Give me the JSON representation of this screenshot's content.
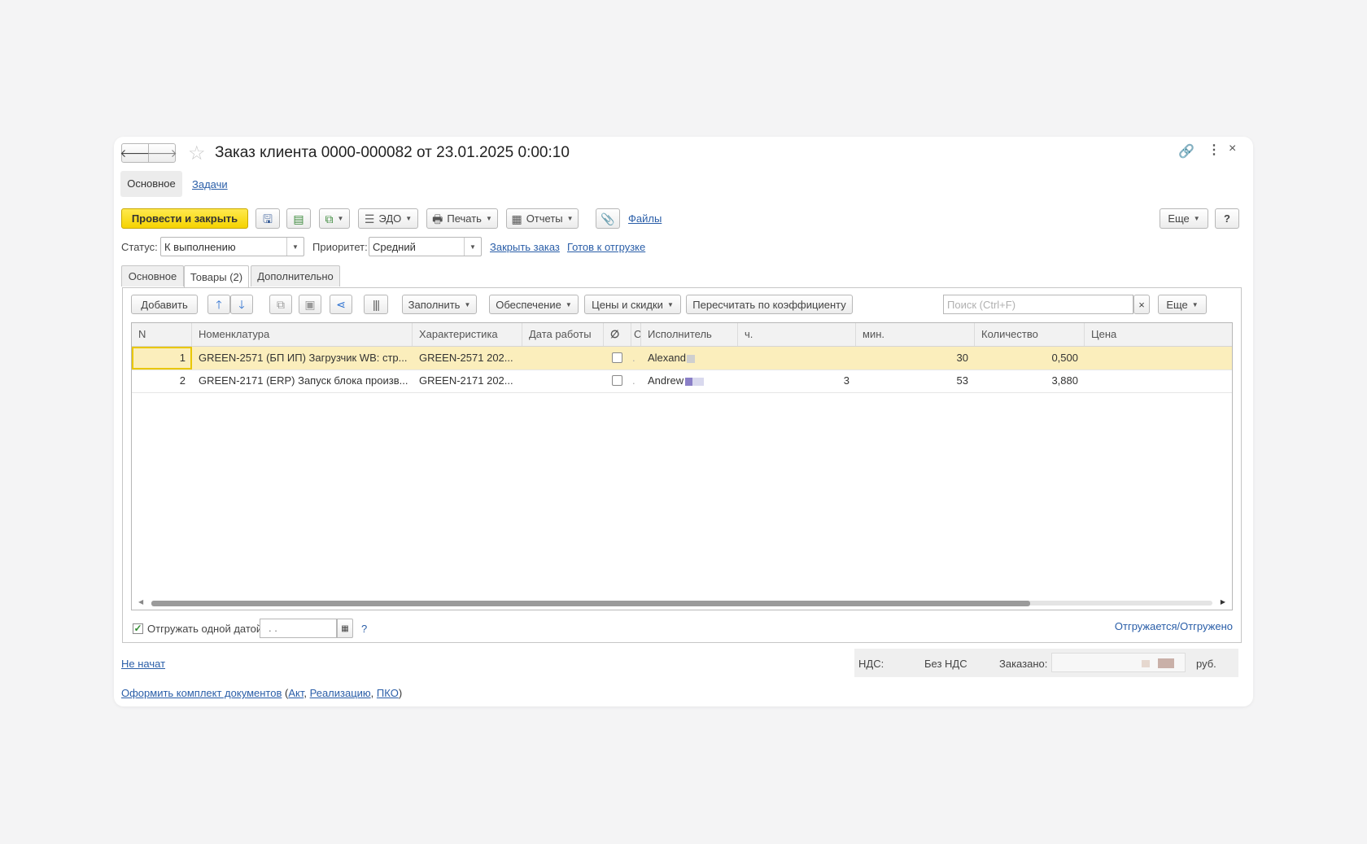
{
  "window": {
    "title": "Заказ клиента 0000-000082 от 23.01.2025 0:00:10",
    "nav_tabs": [
      "Основное",
      "Задачи"
    ]
  },
  "toolbar": {
    "post_close": "Провести и закрыть",
    "edo": "ЭДО",
    "print": "Печать",
    "reports": "Отчеты",
    "files": "Файлы",
    "more": "Еще",
    "help": "?"
  },
  "status_row": {
    "status_label": "Статус:",
    "status_value": "К выполнению",
    "priority_label": "Приоритет:",
    "priority_value": "Средний",
    "close_order": "Закрыть заказ",
    "ready_ship": "Готов к отгрузке"
  },
  "tabs": [
    "Основное",
    "Товары (2)",
    "Дополнительно"
  ],
  "table_toolbar": {
    "add": "Добавить",
    "fill": "Заполнить",
    "supply": "Обеспечение",
    "prices": "Цены и скидки",
    "recalc": "Пересчитать по коэффициенту",
    "search_placeholder": "Поиск (Ctrl+F)",
    "clear": "×",
    "more": "Еще"
  },
  "table": {
    "columns": [
      "N",
      "Номенклатура",
      "Характеристика",
      "Дата работы",
      "∅",
      "С",
      "Исполнитель",
      "ч.",
      "мин.",
      "Количество",
      "Цена"
    ],
    "rows": [
      {
        "n": "1",
        "item": "GREEN-2571 (БП ИП) Загрузчик WB: стр...",
        "characteristic": "GREEN-2571 202...",
        "date": "",
        "flag": ".",
        "executor": "Alexand",
        "hours": "",
        "minutes": "30",
        "qty": "0,500",
        "price": ""
      },
      {
        "n": "2",
        "item": "GREEN-2171 (ERP) Запуск блока произв...",
        "characteristic": "GREEN-2171 202...",
        "date": "",
        "flag": ".",
        "executor": "Andrew",
        "hours": "3",
        "minutes": "53",
        "qty": "3,880",
        "price": ""
      }
    ]
  },
  "bottom": {
    "ship_one_date": "Отгружать одной датой",
    "date_value": ". .",
    "help": "?",
    "shipping_link": "Отгружается/Отгружено"
  },
  "footer": {
    "status_link": "Не начат",
    "nds_label": "НДС:",
    "nds_value": "Без НДС",
    "ordered_label": "Заказано:",
    "currency": "руб.",
    "docs_link": "Оформить комплект документов",
    "paren_open": "(",
    "act": "Акт",
    "comma1": ",",
    "realization": "Реализацию",
    "comma2": ",",
    "pko": "ПКО",
    "paren_close": ")"
  }
}
